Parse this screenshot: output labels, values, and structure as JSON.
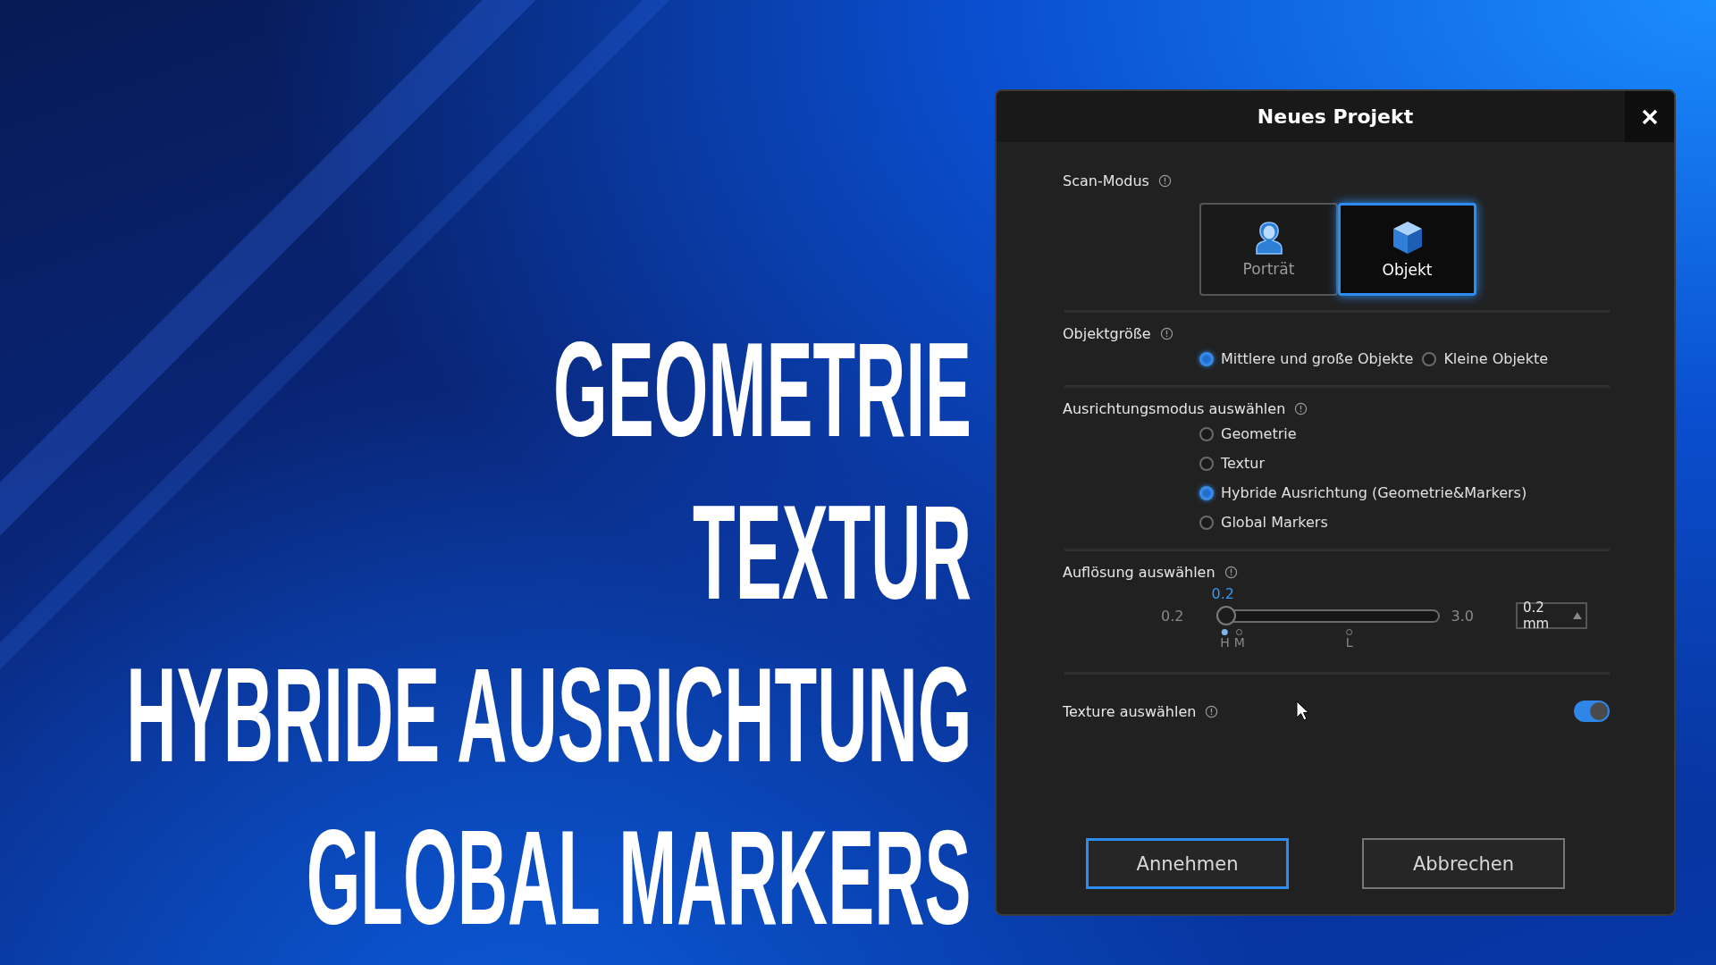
{
  "headline_lines": [
    "GEOMETRIE",
    "TEXTUR",
    "HYBRIDE AUSRICHTUNG",
    "GLOBAL MARKERS"
  ],
  "dialog": {
    "title": "Neues Projekt",
    "scan_mode": {
      "label": "Scan-Modus",
      "options": [
        {
          "label": "Porträt",
          "kind": "person",
          "selected": false
        },
        {
          "label": "Objekt",
          "kind": "cube",
          "selected": true
        }
      ]
    },
    "object_size": {
      "label": "Objektgröße",
      "options": [
        {
          "label": "Mittlere und große Objekte",
          "selected": true
        },
        {
          "label": "Kleine Objekte",
          "selected": false
        }
      ]
    },
    "alignment_mode": {
      "label": "Ausrichtungsmodus auswählen",
      "options": [
        {
          "label": "Geometrie",
          "selected": false
        },
        {
          "label": "Textur",
          "selected": false
        },
        {
          "label": "Hybride Ausrichtung (Geometrie&Markers)",
          "selected": true
        },
        {
          "label": "Global Markers",
          "selected": false
        }
      ]
    },
    "resolution": {
      "label": "Auflösung auswählen",
      "current": "0.2",
      "min": "0.2",
      "max": "3.0",
      "level": 0,
      "value": "0.2 mm",
      "presets": [
        {
          "label": "H",
          "selected": true
        },
        {
          "label": "M",
          "selected": false
        },
        {
          "label": "L",
          "selected": false
        }
      ]
    },
    "texture": {
      "label": "Texture auswählen",
      "on": true
    },
    "buttons": [
      {
        "label": "Annehmen",
        "kind": "primary"
      },
      {
        "label": "Abbrechen",
        "kind": "secondary"
      }
    ]
  }
}
